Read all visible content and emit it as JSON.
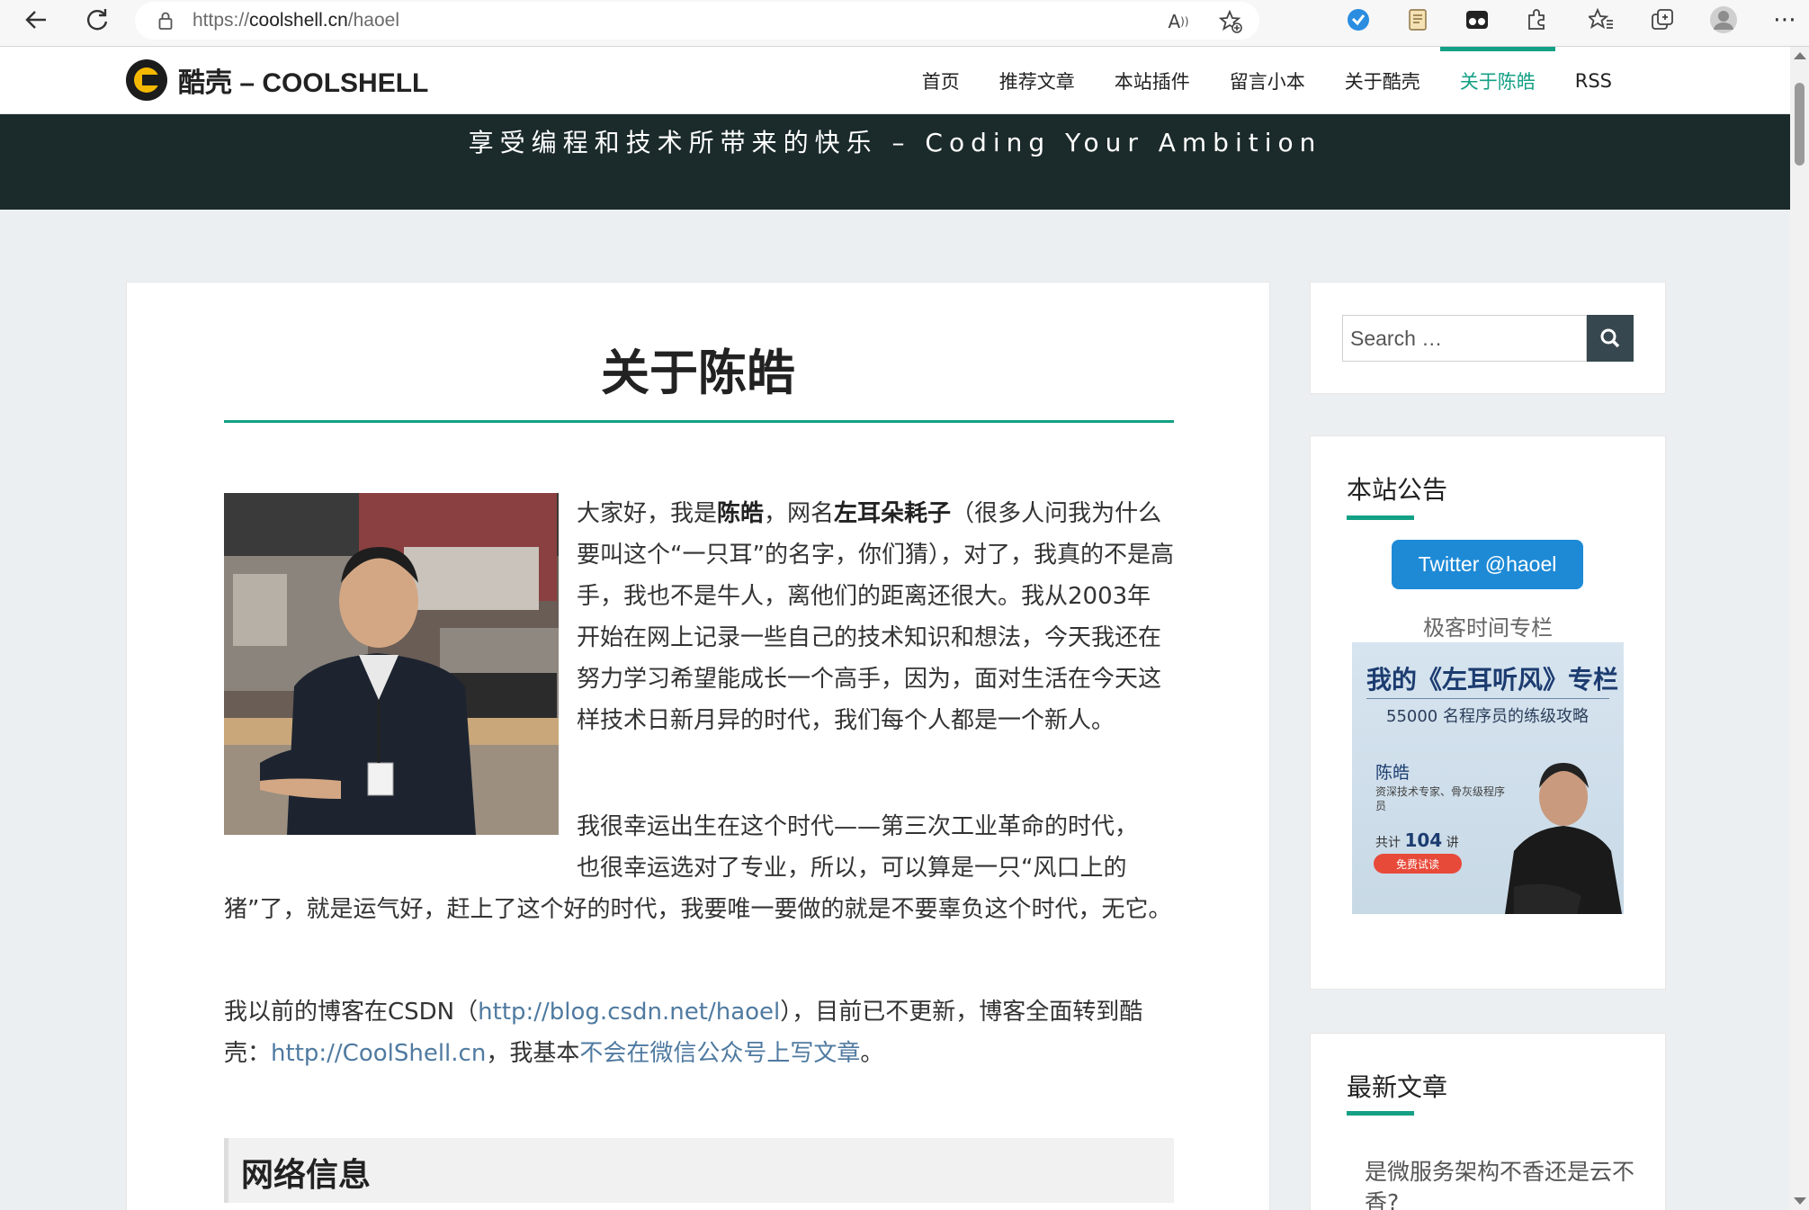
{
  "browser": {
    "url_prefix": "https://",
    "url_host": "coolshell.cn",
    "url_path": "/haoel",
    "back_icon": "←",
    "reload_icon": "↻",
    "more_icon": "⋯"
  },
  "site": {
    "logo_text": "酷壳 – COOLSHELL",
    "nav": [
      "首页",
      "推荐文章",
      "本站插件",
      "留言小本",
      "关于酷壳",
      "关于陈皓",
      "RSS"
    ],
    "active_nav": "关于陈皓",
    "tagline": "享受编程和技术所带来的快乐 – Coding Your Ambition",
    "accent_color": "#14a085"
  },
  "article": {
    "title": "关于陈皓",
    "p1": {
      "t1": "大家好，我是",
      "b1": "陈皓",
      "t2": "，网名",
      "b2": "左耳朵耗子",
      "t3": "（很多人问我为什么要叫这个“一只耳”的名字，你们猜），对了，我真的不是高手，我也不是牛人，离他们的距离还很大。我从2003年开始在网上记录一些自己的技术知识和想法，今天我还在努力学习希望能成长一个高手，因为，面对生活在今天这样技术日新月异的时代，我们每个人都是一个新人。"
    },
    "p2": {
      "line1": "我很幸运出生在这个时代——第三次工业革命的时代，",
      "line2": "也很幸运选对了专业，所以，可以算是一只“风口上的",
      "rest": "猪”了，就是运气好，赶上了这个好的时代，我要唯一要做的就是不要辜负这个时代，无它。"
    },
    "p3": {
      "t1": "我以前的博客在CSDN（",
      "link1": "http://blog.csdn.net/haoel",
      "t2": "），目前已不更新，博客全面转到酷壳：",
      "link2": "http://CoolShell.cn",
      "t3": "，我基本",
      "link3": "不会在微信公众号上写文章",
      "t4": "。"
    },
    "section_heading": "网络信息"
  },
  "sidebar": {
    "search_placeholder": "Search …",
    "notice_title": "本站公告",
    "twitter_button": "Twitter @haoel",
    "geek_label": "极客时间专栏",
    "ad": {
      "title": "我的《左耳听风》专栏",
      "subtitle": "55000 名程序员的练级攻略",
      "name": "陈皓",
      "desc": "资深技术专家、骨灰级程序员",
      "count_prefix": "共计",
      "count": "104",
      "count_suffix": "讲",
      "try": "免费试读"
    },
    "latest_title": "最新文章",
    "latest_items": [
      "是微服务架构不香还是云不香?"
    ]
  }
}
